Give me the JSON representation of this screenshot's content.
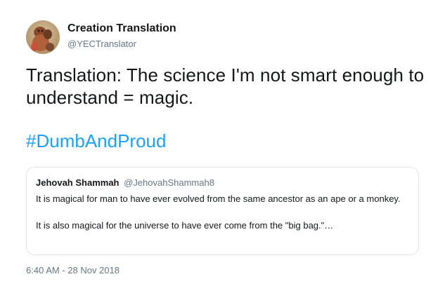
{
  "tweet": {
    "author": {
      "name": "Creation Translation",
      "handle": "@YECTranslator",
      "avatar_icon": "profile-photo-icon"
    },
    "text": "Translation: The science I'm not smart enough to understand = magic.",
    "hashtag": "#DumbAndProud",
    "quoted_tweet": {
      "name": "Jehovah Shammah",
      "handle": "@JehovahShammah8",
      "paragraph_1": "It is magical for man to have ever evolved from the same ancestor as an ape or a monkey.",
      "paragraph_2": "It is also magical for the universe to have ever come from the \"big bag.\"…"
    },
    "timestamp": "6:40 AM - 28 Nov 2018"
  },
  "colors": {
    "text": "#14171a",
    "secondary_text": "#657786",
    "link": "#1da1f2",
    "border": "#e1e8ed"
  }
}
